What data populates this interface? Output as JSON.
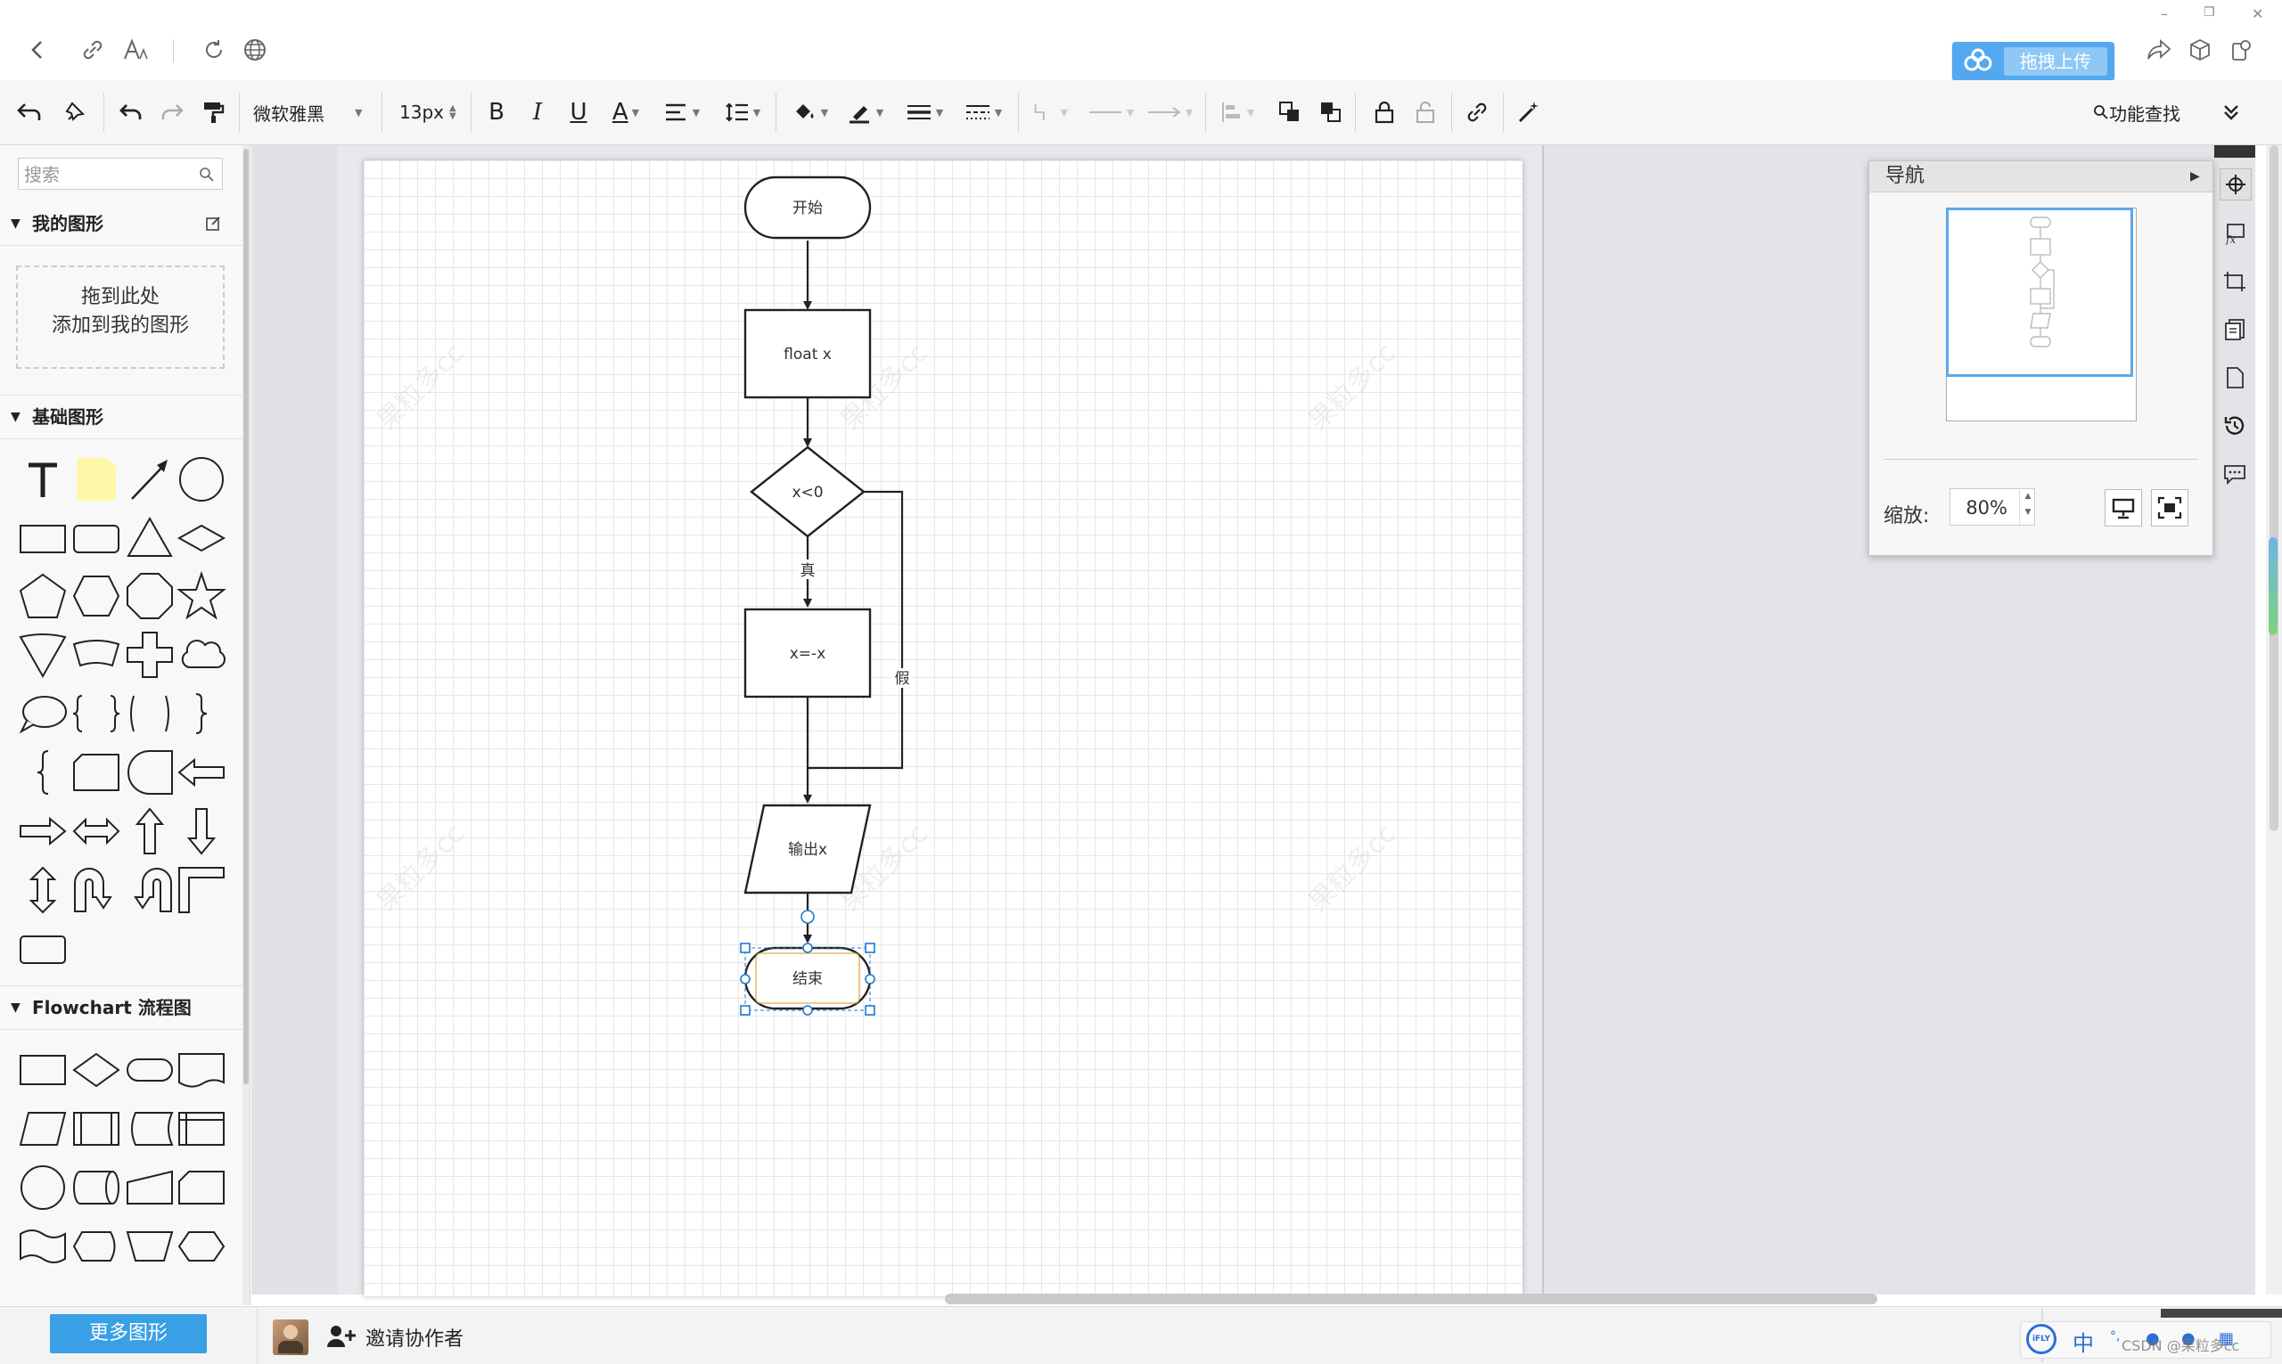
{
  "topbar": {
    "upload_label": "拖拽上传"
  },
  "toolbar": {
    "font_family": "微软雅黑",
    "font_size": "13px",
    "bold": "B",
    "italic": "I",
    "underline": "U",
    "font_color": "A",
    "feature_search": "功能查找"
  },
  "left_panel": {
    "search_placeholder": "搜索",
    "my_shapes_title": "我的图形",
    "drop_hint_line1": "拖到此处",
    "drop_hint_line2": "添加到我的图形",
    "basic_shapes_title": "基础图形",
    "flowchart_title": "Flowchart 流程图",
    "more_shapes_button": "更多图形"
  },
  "bottom_bar": {
    "invite_label": "邀请协作者",
    "ime_label": "中",
    "csdn_label": "CSDN @果粒多cc"
  },
  "watermark": "果粒多cc",
  "diagram": {
    "start_label": "开始",
    "declare_label": "float x",
    "condition_label": "x<0",
    "true_label": "真",
    "false_label": "假",
    "assign_label": "x=-x",
    "output_label": "输出x",
    "end_label": "结束"
  },
  "navigator": {
    "title": "导航",
    "zoom_label": "缩放:",
    "zoom_value": "80%"
  },
  "colors": {
    "accent": "#3aa0e6",
    "upload": "#53a8f0",
    "selection": "#1e78d2"
  }
}
